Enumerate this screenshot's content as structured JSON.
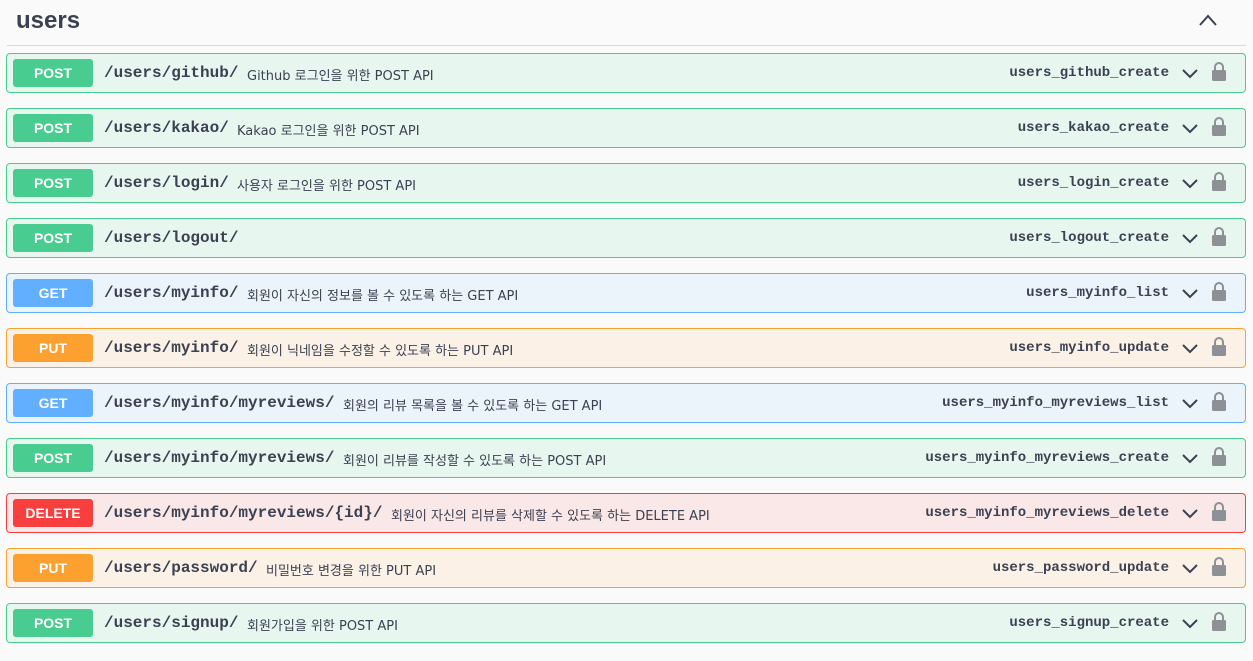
{
  "tag": {
    "title": "users"
  },
  "operations": [
    {
      "method": "POST",
      "path": "/users/github/",
      "summary": "Github 로그인을 위한 POST API",
      "operation_id": "users_github_create"
    },
    {
      "method": "POST",
      "path": "/users/kakao/",
      "summary": "Kakao 로그인을 위한 POST API",
      "operation_id": "users_kakao_create"
    },
    {
      "method": "POST",
      "path": "/users/login/",
      "summary": "사용자 로그인을 위한 POST API",
      "operation_id": "users_login_create"
    },
    {
      "method": "POST",
      "path": "/users/logout/",
      "summary": "",
      "operation_id": "users_logout_create"
    },
    {
      "method": "GET",
      "path": "/users/myinfo/",
      "summary": "회원이 자신의 정보를 볼 수 있도록 하는 GET API",
      "operation_id": "users_myinfo_list"
    },
    {
      "method": "PUT",
      "path": "/users/myinfo/",
      "summary": "회원이 닉네임을 수정할 수 있도록 하는 PUT API",
      "operation_id": "users_myinfo_update"
    },
    {
      "method": "GET",
      "path": "/users/myinfo/myreviews/",
      "summary": "회원의 리뷰 목록을 볼 수 있도록 하는 GET API",
      "operation_id": "users_myinfo_myreviews_list"
    },
    {
      "method": "POST",
      "path": "/users/myinfo/myreviews/",
      "summary": "회원이 리뷰를 작성할 수 있도록 하는 POST API",
      "operation_id": "users_myinfo_myreviews_create"
    },
    {
      "method": "DELETE",
      "path": "/users/myinfo/myreviews/{id}/",
      "summary": "회원이 자신의 리뷰를 삭제할 수 있도록 하는 DELETE API",
      "operation_id": "users_myinfo_myreviews_delete"
    },
    {
      "method": "PUT",
      "path": "/users/password/",
      "summary": "비밀번호 변경을 위한 PUT API",
      "operation_id": "users_password_update"
    },
    {
      "method": "POST",
      "path": "/users/signup/",
      "summary": "회원가입을 위한 POST API",
      "operation_id": "users_signup_create"
    }
  ],
  "colors": {
    "post": "#49cc90",
    "get": "#61affe",
    "put": "#fca130",
    "delete": "#f93e3e"
  },
  "icons": {
    "collapse": "chevron-up-icon",
    "expand": "chevron-down-icon",
    "auth": "lock-icon"
  }
}
